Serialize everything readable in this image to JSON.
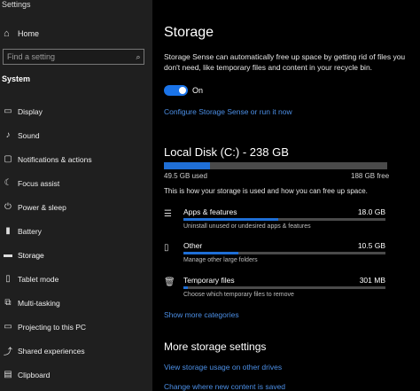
{
  "window": {
    "title": "Settings"
  },
  "sidebar": {
    "home_label": "Home",
    "search_placeholder": "Find a setting",
    "section_label": "System",
    "items": [
      {
        "label": "Display",
        "icon": "display-icon"
      },
      {
        "label": "Sound",
        "icon": "sound-icon"
      },
      {
        "label": "Notifications & actions",
        "icon": "notifications-icon"
      },
      {
        "label": "Focus assist",
        "icon": "moon-icon"
      },
      {
        "label": "Power & sleep",
        "icon": "power-icon"
      },
      {
        "label": "Battery",
        "icon": "battery-icon"
      },
      {
        "label": "Storage",
        "icon": "storage-icon",
        "active": true
      },
      {
        "label": "Tablet mode",
        "icon": "tablet-icon"
      },
      {
        "label": "Multi-tasking",
        "icon": "multitasking-icon"
      },
      {
        "label": "Projecting to this PC",
        "icon": "projecting-icon"
      },
      {
        "label": "Shared experiences",
        "icon": "shared-icon"
      },
      {
        "label": "Clipboard",
        "icon": "clipboard-icon"
      }
    ]
  },
  "main": {
    "title": "Storage",
    "description": "Storage Sense can automatically free up space by getting rid of files you don't need, like temporary files and content in your recycle bin.",
    "toggle_state": "On",
    "configure_link": "Configure Storage Sense or run it now",
    "disk_title": "Local Disk (C:) - 238 GB",
    "used": "49.5 GB used",
    "free": "188 GB free",
    "used_fraction": 0.208,
    "how_text": "This is how your storage is used and how you can free up space.",
    "categories": [
      {
        "name": "Apps & features",
        "size": "18.0 GB",
        "sub": "Uninstall unused or undesired apps & features",
        "fraction": 0.47,
        "icon": "apps-icon"
      },
      {
        "name": "Other",
        "size": "10.5 GB",
        "sub": "Manage other large folders",
        "fraction": 0.27,
        "icon": "other-icon"
      },
      {
        "name": "Temporary files",
        "size": "301 MB",
        "sub": "Choose which temporary files to remove",
        "fraction": 0.02,
        "icon": "trash-icon"
      }
    ],
    "show_more": "Show more categories",
    "more_title": "More storage settings",
    "more_links": [
      "View storage usage on other drives",
      "Change where new content is saved"
    ]
  },
  "colors": {
    "accent": "#1f6fd6",
    "link": "#4c8fe6",
    "sidebar_bg": "#1f1f1f",
    "main_bg": "#000000"
  }
}
